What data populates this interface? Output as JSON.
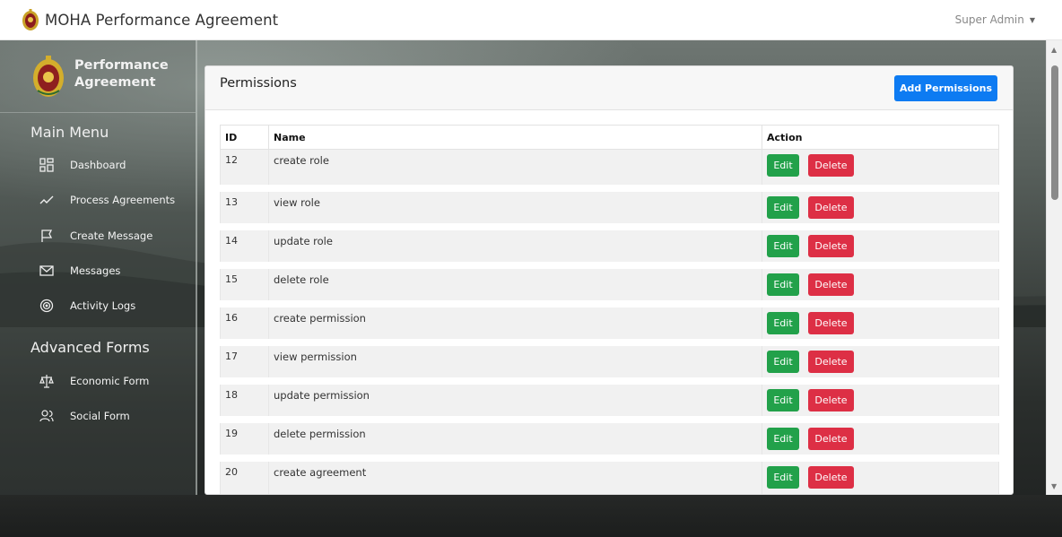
{
  "topbar": {
    "app_title": "MOHA Performance Agreement",
    "user": "Super Admin"
  },
  "sidebar": {
    "brand": "Performance Agreement",
    "main_menu_title": "Main Menu",
    "main_items": [
      {
        "label": "Dashboard",
        "icon": "dashboard-icon"
      },
      {
        "label": "Process Agreements",
        "icon": "chart-line-icon"
      },
      {
        "label": "Create Message",
        "icon": "flag-icon"
      },
      {
        "label": "Messages",
        "icon": "mail-icon"
      },
      {
        "label": "Activity Logs",
        "icon": "target-icon"
      }
    ],
    "advanced_title": "Advanced Forms",
    "advanced_items": [
      {
        "label": "Economic Form",
        "icon": "scale-icon"
      },
      {
        "label": "Social Form",
        "icon": "users-icon"
      }
    ]
  },
  "card": {
    "title": "Permissions",
    "add_button": "Add Permissions",
    "columns": [
      "ID",
      "Name",
      "Action"
    ],
    "edit_label": "Edit",
    "delete_label": "Delete",
    "rows": [
      {
        "id": "12",
        "name": "create role"
      },
      {
        "id": "13",
        "name": "view role"
      },
      {
        "id": "14",
        "name": "update role"
      },
      {
        "id": "15",
        "name": "delete role"
      },
      {
        "id": "16",
        "name": "create permission"
      },
      {
        "id": "17",
        "name": "view permission"
      },
      {
        "id": "18",
        "name": "update permission"
      },
      {
        "id": "19",
        "name": "delete permission"
      },
      {
        "id": "20",
        "name": "create agreement"
      }
    ]
  },
  "colors": {
    "primary": "#0d7bf2",
    "edit": "#22a14a",
    "delete": "#dd2f45"
  }
}
